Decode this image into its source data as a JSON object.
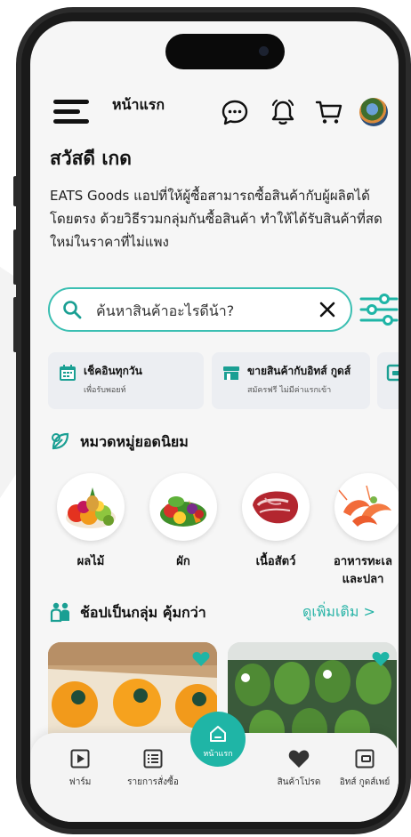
{
  "header": {
    "title": "หน้าแรก",
    "greeting": "สวัสดี เกด",
    "description": "EATS Goods แอปที่ให้ผู้ซื้อสามารถซื้อสินค้ากับผู้ผลิตได้โดยตรง ด้วยวิธีรวมกลุ่มกันซื้อสินค้า ทำให้ได้รับสินค้าที่สดใหม่ในราคาที่ไม่แพง"
  },
  "search": {
    "value": "ค้นหาสินค้าอะไรดีน้า?"
  },
  "promos": [
    {
      "title": "เช็คอินทุกวัน",
      "subtitle": "เพื่อรับพอยท์",
      "icon": "calendar-icon"
    },
    {
      "title": "ขายสินค้ากับอิทส์ กูดส์",
      "subtitle": "สมัครฟรี ไม่มีค่าแรกเข้า",
      "icon": "store-icon"
    },
    {
      "title": "",
      "subtitle": "",
      "icon": "wallet-icon"
    }
  ],
  "categories_section": {
    "title": "หมวดหมู่ยอดนิยม",
    "items": [
      {
        "label": "ผลไม้"
      },
      {
        "label": "ผัก"
      },
      {
        "label": "เนื้อสัตว์"
      },
      {
        "label": "อาหารทะเลและปลา"
      }
    ]
  },
  "group_section": {
    "title": "ช้อปเป็นกลุ่ม คุ้มกว่า",
    "see_more": "ดูเพิ่มเติม >"
  },
  "bottom_nav": {
    "items": [
      {
        "label": "ฟาร์ม"
      },
      {
        "label": "รายการสั่งซื้อ"
      },
      {
        "label": "หน้าแรก"
      },
      {
        "label": "สินค้าโปรด"
      },
      {
        "label": "อิทส์ กูดส์เพย์"
      }
    ]
  },
  "colors": {
    "accent": "#1fb5a6",
    "search_border": "#3bbfb2"
  }
}
